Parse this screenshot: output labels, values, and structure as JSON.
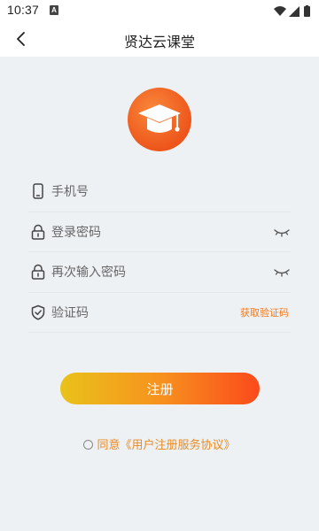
{
  "status_bar": {
    "time": "10:37",
    "notification_icon": "a-icon",
    "right_icons": [
      "wifi-icon",
      "signal-icon",
      "battery-icon"
    ]
  },
  "header": {
    "back_icon": "chevron-left-icon",
    "title": "贤达云课堂"
  },
  "logo": {
    "icon": "graduation-cap-icon",
    "colors": {
      "outer": "#f26a22",
      "inner": "#ffffff"
    }
  },
  "form": {
    "phone": {
      "icon": "phone-icon",
      "placeholder": "手机号"
    },
    "password": {
      "icon": "lock-icon",
      "placeholder": "登录密码",
      "toggle_icon": "eye-closed-icon"
    },
    "confirm_password": {
      "icon": "lock-icon",
      "placeholder": "再次输入密码",
      "toggle_icon": "eye-closed-icon"
    },
    "verify_code": {
      "icon": "shield-check-icon",
      "placeholder": "验证码",
      "get_code_label": "获取验证码"
    }
  },
  "register_button": {
    "label": "注册"
  },
  "agreement": {
    "checked": false,
    "text": "同意《用户注册服务协议》"
  },
  "colors": {
    "accent": "#f07a1e",
    "button_gradient": [
      "#e9c21a",
      "#f7921e",
      "#fb4a1c"
    ],
    "background": "#eef1f4"
  }
}
